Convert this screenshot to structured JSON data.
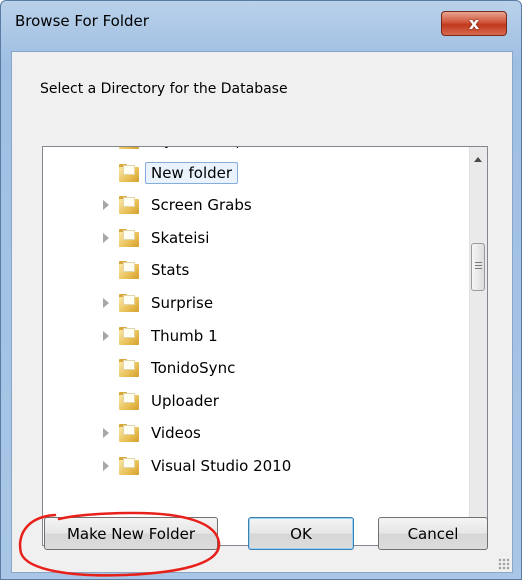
{
  "window": {
    "title": "Browse For Folder",
    "close_label": "x"
  },
  "dialog": {
    "prompt": "Select a Directory for the Database"
  },
  "tree": {
    "items": [
      {
        "label": "MySQL Scripts",
        "expandable": false,
        "selected": false
      },
      {
        "label": "New folder",
        "expandable": false,
        "selected": true
      },
      {
        "label": "Screen Grabs",
        "expandable": true,
        "selected": false
      },
      {
        "label": "Skateisi",
        "expandable": true,
        "selected": false
      },
      {
        "label": "Stats",
        "expandable": false,
        "selected": false
      },
      {
        "label": "Surprise",
        "expandable": true,
        "selected": false
      },
      {
        "label": "Thumb 1",
        "expandable": true,
        "selected": false
      },
      {
        "label": "TonidoSync",
        "expandable": false,
        "selected": false
      },
      {
        "label": "Uploader",
        "expandable": false,
        "selected": false
      },
      {
        "label": "Videos",
        "expandable": true,
        "selected": false
      },
      {
        "label": "Visual Studio 2010",
        "expandable": true,
        "selected": false
      }
    ]
  },
  "buttons": {
    "make_new_folder": "Make New Folder",
    "ok": "OK",
    "cancel": "Cancel"
  },
  "colors": {
    "selection_border": "#84acdd",
    "selection_fill": "#eaf3fd",
    "annotation": "#e8201a"
  }
}
